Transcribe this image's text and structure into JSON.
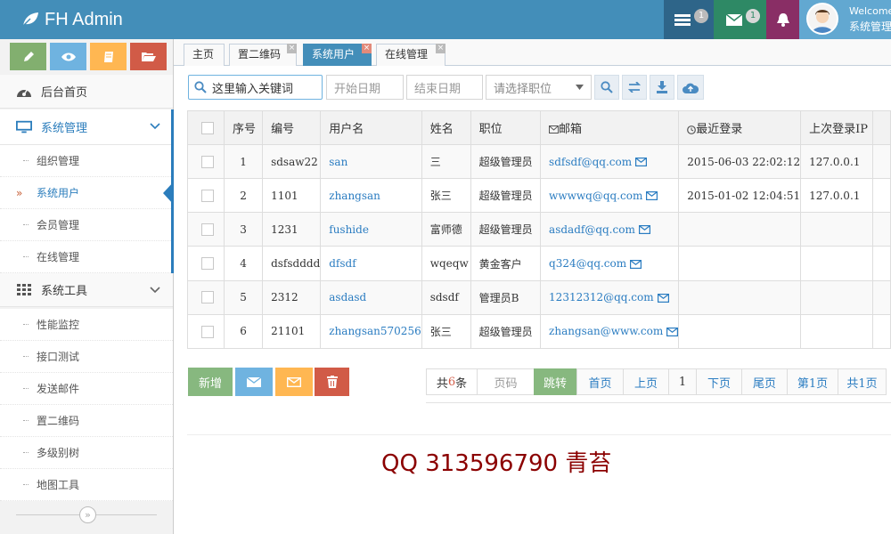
{
  "brand": {
    "title": "FH Admin"
  },
  "topbar": {
    "tasks_badge": "1",
    "messages_badge": "1",
    "welcome": "Welcome",
    "user_name": "系统管理员"
  },
  "sidebar": {
    "menus": [
      {
        "label": "后台首页",
        "icon": "dashboard-icon"
      },
      {
        "label": "系统管理",
        "icon": "desktop-icon",
        "active": true,
        "sub": [
          "组织管理",
          "系统用户",
          "会员管理",
          "在线管理"
        ],
        "active_sub": "系统用户"
      },
      {
        "label": "系统工具",
        "icon": "th-icon",
        "sub": [
          "性能监控",
          "接口测试",
          "发送邮件",
          "置二维码",
          "多级别树",
          "地图工具"
        ]
      }
    ]
  },
  "tabs": [
    {
      "label": "主页",
      "closable": false
    },
    {
      "label": "置二维码",
      "closable": true
    },
    {
      "label": "系统用户",
      "closable": true,
      "active": true
    },
    {
      "label": "在线管理",
      "closable": true
    }
  ],
  "search": {
    "keyword_placeholder": "这里输入关键词",
    "start_date_placeholder": "开始日期",
    "end_date_placeholder": "结束日期",
    "role_select": "请选择职位"
  },
  "table": {
    "columns": [
      "",
      "序号",
      "编号",
      "用户名",
      "姓名",
      "职位",
      "邮箱",
      "最近登录",
      "上次登录IP"
    ],
    "rows": [
      [
        "1",
        "sdsaw22",
        "san",
        "三",
        "超级管理员",
        "sdfsdf@qq.com",
        "2015-06-03 22:02:12",
        "127.0.0.1"
      ],
      [
        "2",
        "1101",
        "zhangsan",
        "张三",
        "超级管理员",
        "wwwwq@qq.com",
        "2015-01-02 12:04:51",
        "127.0.0.1"
      ],
      [
        "3",
        "1231",
        "fushide",
        "富师德",
        "超级管理员",
        "asdadf@qq.com",
        "",
        ""
      ],
      [
        "4",
        "dsfsdddd",
        "dfsdf",
        "wqeqw",
        "黄金客户",
        "q324@qq.com",
        "",
        ""
      ],
      [
        "5",
        "2312",
        "asdasd",
        "sdsdf",
        "管理员B",
        "12312312@qq.com",
        "",
        ""
      ],
      [
        "6",
        "21101",
        "zhangsan570256",
        "张三",
        "超级管理员",
        "zhangsan@www.com",
        "",
        ""
      ]
    ]
  },
  "actions": {
    "add_label": "新增"
  },
  "pager": {
    "total_prefix": "共",
    "total_count": "6",
    "total_suffix": "条",
    "page_input_placeholder": "页码",
    "jump": "跳转",
    "first": "首页",
    "prev": "上页",
    "current": "1",
    "next": "下页",
    "last": "尾页",
    "page_of": "第1页",
    "total_pages": "共1页"
  },
  "footer": {
    "text": "QQ 313596790 青苔"
  }
}
